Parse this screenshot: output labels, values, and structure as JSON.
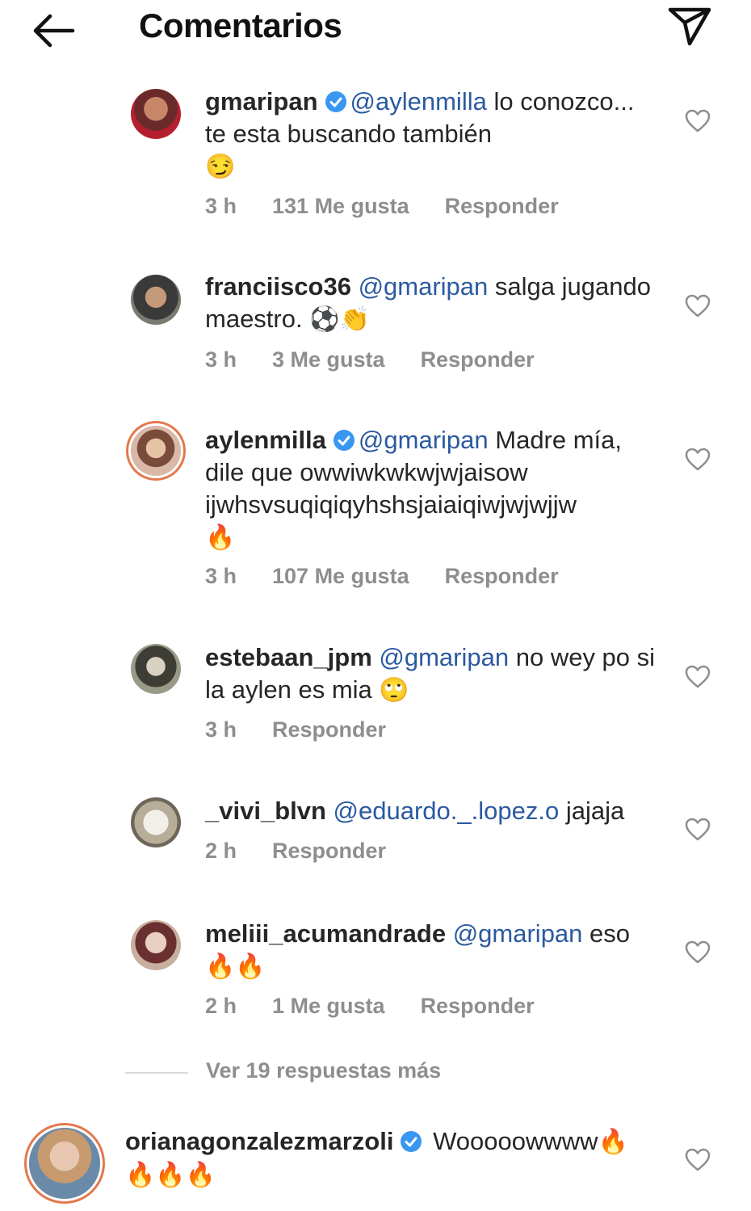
{
  "header": {
    "title": "Comentarios",
    "back_icon": "arrow-left-icon",
    "share_icon": "paper-plane-icon"
  },
  "comments": [
    {
      "username": "gmaripan",
      "verified": true,
      "mention": "@aylenmilla",
      "text": " lo conozco... te esta buscando también",
      "emoji": "😏",
      "time": "3 h",
      "likes": "131 Me gusta",
      "reply": "Responder"
    },
    {
      "username": "franciisco36",
      "verified": false,
      "mention": "@gmaripan",
      "text": " salga jugando maestro. ",
      "emoji": "⚽👏",
      "time": "3 h",
      "likes": "3 Me gusta",
      "reply": "Responder"
    },
    {
      "username": "aylenmilla",
      "verified": true,
      "mention": "@gmaripan",
      "text": " Madre mía, dile que owwiwkwkwjwjaisow ijwhsvsuqiqiqyhshsjaiaiqiwjwjwjjw",
      "emoji": "🔥",
      "time": "3 h",
      "likes": "107 Me gusta",
      "reply": "Responder"
    },
    {
      "username": "estebaan_jpm",
      "verified": false,
      "mention": "@gmaripan",
      "text": " no wey po si la aylen es mia ",
      "emoji": "🙄",
      "time": "3 h",
      "reply": "Responder"
    },
    {
      "username": "_vivi_blvn",
      "verified": false,
      "mention": "@eduardo._.lopez.o",
      "text": " jajaja",
      "time": "2 h",
      "reply": "Responder"
    },
    {
      "username": "meliii_acumandrade",
      "verified": false,
      "mention": "@gmaripan",
      "text": " eso",
      "emoji": "🔥🔥",
      "time": "2 h",
      "likes": "1 Me gusta",
      "reply": "Responder"
    }
  ],
  "view_more": "Ver 19 respuestas más",
  "main_comment": {
    "username": "orianagonzalezmarzoli",
    "verified": true,
    "text": "Wooooowwww",
    "emoji": "🔥",
    "emoji2": "🔥🔥🔥"
  },
  "colors": {
    "mention": "#2a5aa0",
    "verified": "#3897f0",
    "meta": "#8e8e8e"
  }
}
